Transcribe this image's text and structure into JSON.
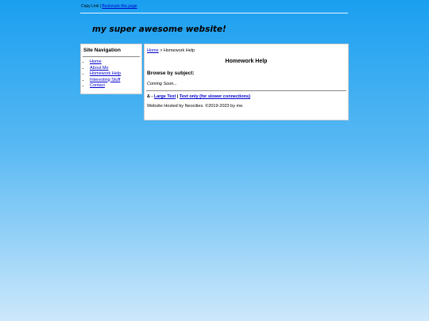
{
  "topbar": {
    "copy_link": "Copy Link",
    "separator": "|",
    "bookmark": "Bookmark this page"
  },
  "header": {
    "title": "my super awesome website!"
  },
  "sidebar": {
    "heading": "Site Navigation",
    "items": [
      {
        "label": "Home"
      },
      {
        "label": "About Me"
      },
      {
        "label": "Homework Help"
      },
      {
        "label": "Interesting Stuff"
      },
      {
        "label": "Contact"
      }
    ]
  },
  "main": {
    "breadcrumb_home": "Home",
    "breadcrumb_rest": " > Homework Help",
    "heading": "Homework Help",
    "browse_label": "Browse by subject:",
    "coming_soon": "Coming Soon...",
    "footer_prefix": "& - ",
    "large_text": "Large Text",
    "sep": " | ",
    "text_only": "Text only (for slower connections)",
    "hosted": "Website Hosted by Neocities. ©2019-2023 by me."
  }
}
